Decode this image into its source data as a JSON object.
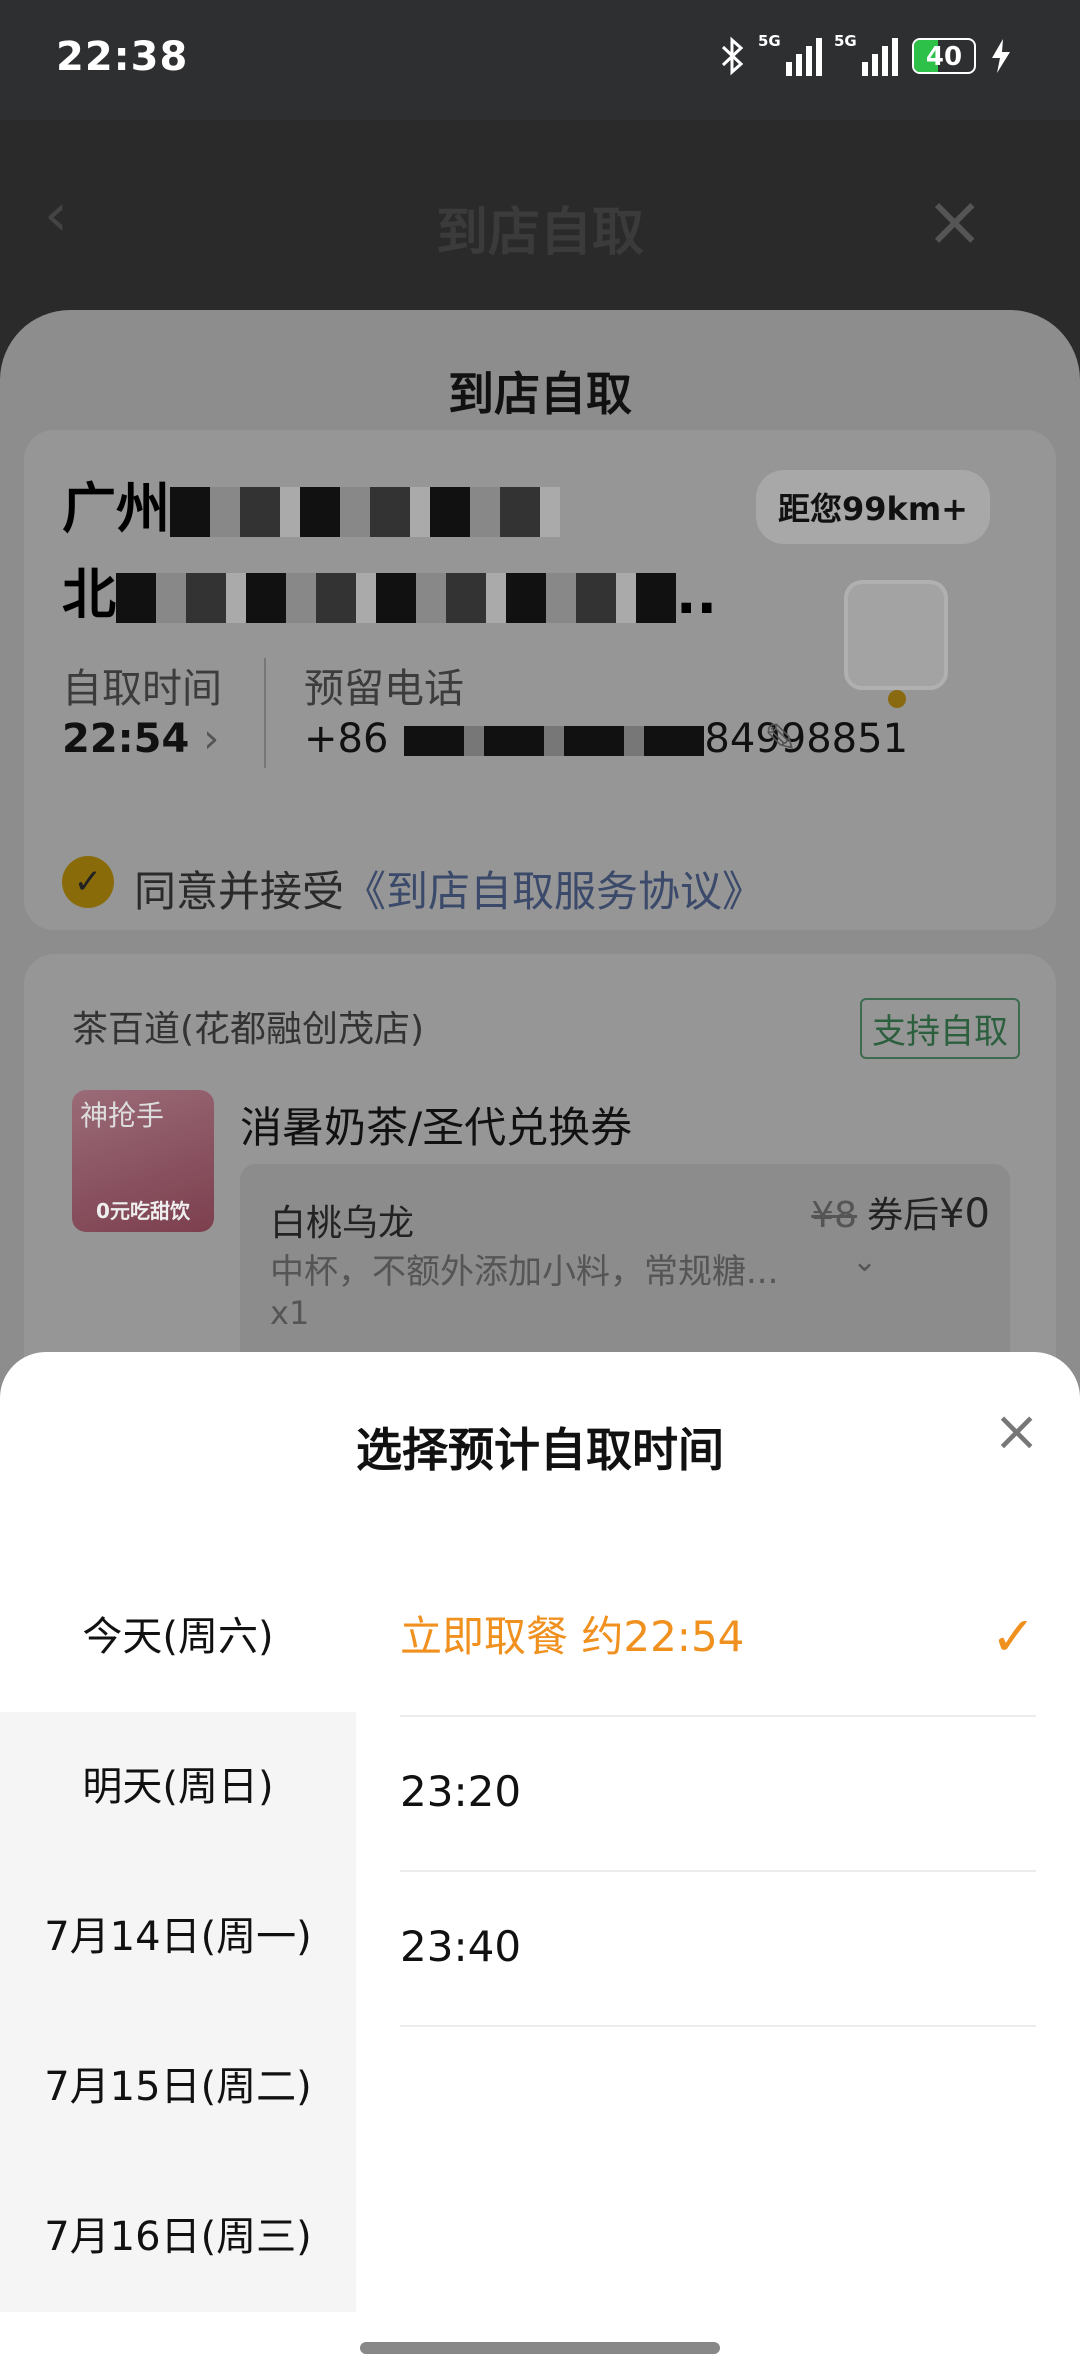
{
  "status_bar": {
    "time": "22:38",
    "bluetooth_icon": "bluetooth-icon",
    "signal1_label": "5G",
    "signal2_label": "5G",
    "battery_level": "40",
    "battery_fraction": 0.4,
    "charging_icon": "bolt-icon"
  },
  "header": {
    "back_icon": "chevron-left-icon",
    "title": "到店自取",
    "close_icon": "close-icon"
  },
  "pickup_sheet": {
    "title": "到店自取",
    "address_line1": "广州",
    "address_line2": "北",
    "address_suffix": "..",
    "distance": "距您99km+",
    "pickup_time_label": "自取时间",
    "pickup_time_value": "22:54",
    "phone_label": "预留电话",
    "phone_prefix": "+86",
    "phone_suffix": "84998851",
    "agree_prefix": "同意并接受",
    "agree_link": "《到店自取服务协议》"
  },
  "order_card": {
    "store_name": "茶百道(花都融创茂店)",
    "support_badge": "支持自取",
    "thumb_badge": "神抢手",
    "thumb_caption": "0元吃甜饮",
    "product_name": "消暑奶茶/圣代兑换券",
    "item_name": "白桃乌龙",
    "original_price": "¥8",
    "after_coupon_label": "券后",
    "final_price": "¥0",
    "item_desc": "中杯，不额外添加小料，常规糖...",
    "quantity": "x1"
  },
  "time_picker": {
    "title": "选择预计自取时间",
    "close_icon": "close-icon",
    "days": [
      {
        "label": "今天(周六)",
        "active": true
      },
      {
        "label": "明天(周日)",
        "active": false
      },
      {
        "label": "7月14日(周一)",
        "active": false
      },
      {
        "label": "7月15日(周二)",
        "active": false
      },
      {
        "label": "7月16日(周三)",
        "active": false
      }
    ],
    "slots": [
      {
        "label": "立即取餐 约22:54",
        "selected": true
      },
      {
        "label": "23:20",
        "selected": false
      },
      {
        "label": "23:40",
        "selected": false
      }
    ],
    "accent_color": "#f0901f"
  }
}
